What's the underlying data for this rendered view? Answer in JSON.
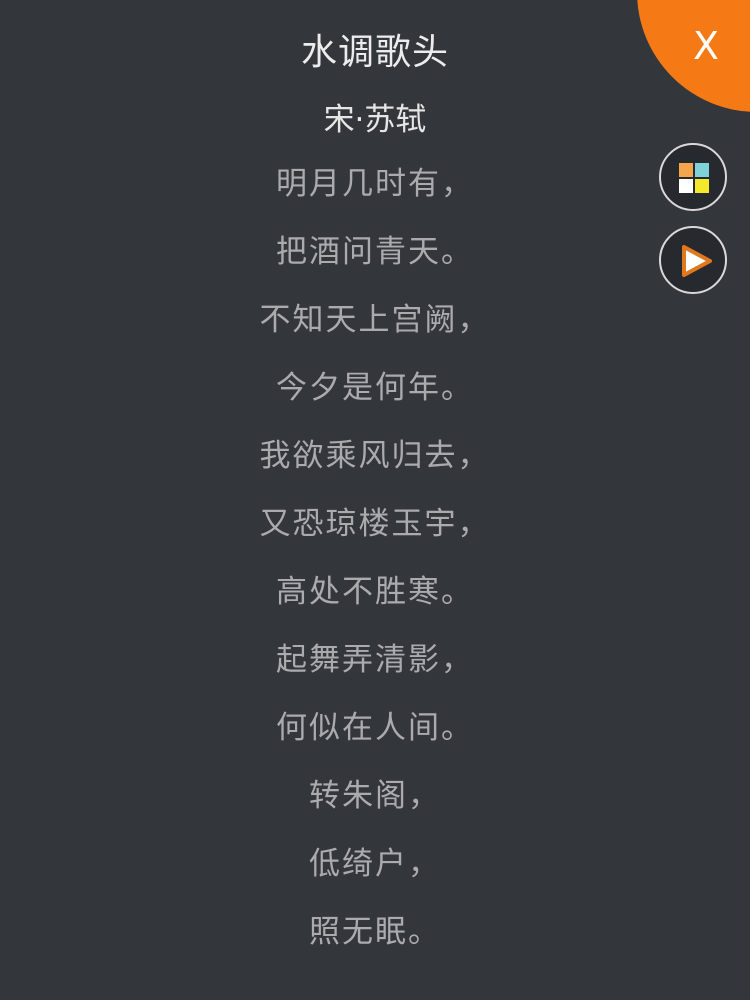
{
  "poem": {
    "title": "水调歌头",
    "author": "宋·苏轼",
    "lines": [
      "明月几时有，",
      "把酒问青天。",
      "不知天上宫阙，",
      "今夕是何年。",
      "我欲乘风归去，",
      "又恐琼楼玉宇，",
      "高处不胜寒。",
      "起舞弄清影，",
      "何似在人间。",
      "转朱阁，",
      "低绮户，",
      "照无眠。"
    ]
  },
  "controls": {
    "close_label": "X",
    "grid_icon": "grid-icon",
    "play_icon": "play-icon"
  },
  "colors": {
    "background": "#33363b",
    "accent": "#f57a16",
    "title_text": "#ececec",
    "body_text": "#a9abaf"
  }
}
